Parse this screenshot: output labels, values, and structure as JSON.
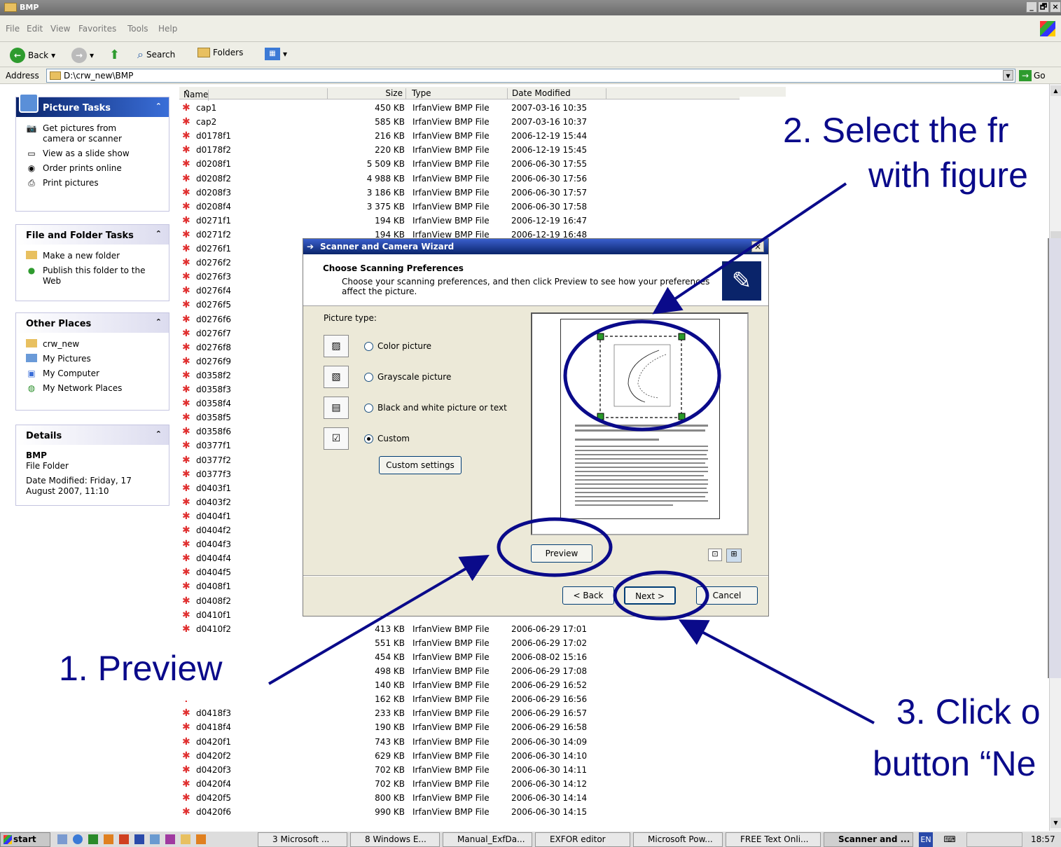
{
  "window": {
    "title": "BMP",
    "controls": [
      "_",
      "🗗",
      "×"
    ]
  },
  "menu": [
    "File",
    "Edit",
    "View",
    "Favorites",
    "Tools",
    "Help"
  ],
  "toolbar": {
    "back": "Back",
    "search": "Search",
    "folders": "Folders"
  },
  "address": {
    "label": "Address",
    "value": "D:\\crw_new\\BMP",
    "go": "Go"
  },
  "panels": {
    "picture_tasks": {
      "title": "Picture Tasks",
      "items": [
        "Get pictures from camera or scanner",
        "View as a slide show",
        "Order prints online",
        "Print pictures"
      ]
    },
    "file_tasks": {
      "title": "File and Folder Tasks",
      "items": [
        "Make a new folder",
        "Publish this folder to the Web"
      ]
    },
    "other_places": {
      "title": "Other Places",
      "items": [
        "crw_new",
        "My Pictures",
        "My Computer",
        "My Network Places"
      ]
    },
    "details": {
      "title": "Details",
      "name": "BMP",
      "kind": "File Folder",
      "modified": "Date Modified: Friday, 17 August 2007, 11:10"
    }
  },
  "columns": {
    "name": "Name",
    "size": "Size",
    "type": "Type",
    "date": "Date Modified"
  },
  "files": [
    {
      "name": "cap1",
      "size": "450 KB",
      "type": "IrfanView BMP File",
      "date": "2007-03-16 10:35"
    },
    {
      "name": "cap2",
      "size": "585 KB",
      "type": "IrfanView BMP File",
      "date": "2007-03-16 10:37"
    },
    {
      "name": "d0178f1",
      "size": "216 KB",
      "type": "IrfanView BMP File",
      "date": "2006-12-19 15:44"
    },
    {
      "name": "d0178f2",
      "size": "220 KB",
      "type": "IrfanView BMP File",
      "date": "2006-12-19 15:45"
    },
    {
      "name": "d0208f1",
      "size": "5 509 KB",
      "type": "IrfanView BMP File",
      "date": "2006-06-30 17:55"
    },
    {
      "name": "d0208f2",
      "size": "4 988 KB",
      "type": "IrfanView BMP File",
      "date": "2006-06-30 17:56"
    },
    {
      "name": "d0208f3",
      "size": "3 186 KB",
      "type": "IrfanView BMP File",
      "date": "2006-06-30 17:57"
    },
    {
      "name": "d0208f4",
      "size": "3 375 KB",
      "type": "IrfanView BMP File",
      "date": "2006-06-30 17:58"
    },
    {
      "name": "d0271f1",
      "size": "194 KB",
      "type": "IrfanView BMP File",
      "date": "2006-12-19 16:47"
    },
    {
      "name": "d0271f2",
      "size": "194 KB",
      "type": "IrfanView BMP File",
      "date": "2006-12-19 16:48"
    },
    {
      "name": "d0276f1",
      "size": "",
      "type": "",
      "date": ""
    },
    {
      "name": "d0276f2",
      "size": "",
      "type": "",
      "date": ""
    },
    {
      "name": "d0276f3",
      "size": "",
      "type": "",
      "date": ""
    },
    {
      "name": "d0276f4",
      "size": "",
      "type": "",
      "date": ""
    },
    {
      "name": "d0276f5",
      "size": "",
      "type": "",
      "date": ""
    },
    {
      "name": "d0276f6",
      "size": "",
      "type": "",
      "date": ""
    },
    {
      "name": "d0276f7",
      "size": "",
      "type": "",
      "date": ""
    },
    {
      "name": "d0276f8",
      "size": "",
      "type": "",
      "date": ""
    },
    {
      "name": "d0276f9",
      "size": "",
      "type": "",
      "date": ""
    },
    {
      "name": "d0358f2",
      "size": "",
      "type": "",
      "date": ""
    },
    {
      "name": "d0358f3",
      "size": "",
      "type": "",
      "date": ""
    },
    {
      "name": "d0358f4",
      "size": "",
      "type": "",
      "date": ""
    },
    {
      "name": "d0358f5",
      "size": "",
      "type": "",
      "date": ""
    },
    {
      "name": "d0358f6",
      "size": "",
      "type": "",
      "date": ""
    },
    {
      "name": "d0377f1",
      "size": "",
      "type": "",
      "date": ""
    },
    {
      "name": "d0377f2",
      "size": "",
      "type": "",
      "date": ""
    },
    {
      "name": "d0377f3",
      "size": "",
      "type": "",
      "date": ""
    },
    {
      "name": "d0403f1",
      "size": "",
      "type": "",
      "date": ""
    },
    {
      "name": "d0403f2",
      "size": "",
      "type": "",
      "date": ""
    },
    {
      "name": "d0404f1",
      "size": "",
      "type": "",
      "date": ""
    },
    {
      "name": "d0404f2",
      "size": "",
      "type": "",
      "date": ""
    },
    {
      "name": "d0404f3",
      "size": "",
      "type": "",
      "date": ""
    },
    {
      "name": "d0404f4",
      "size": "",
      "type": "",
      "date": ""
    },
    {
      "name": "d0404f5",
      "size": "",
      "type": "",
      "date": ""
    },
    {
      "name": "d0408f1",
      "size": "",
      "type": "",
      "date": ""
    },
    {
      "name": "d0408f2",
      "size": "",
      "type": "",
      "date": ""
    },
    {
      "name": "d0410f1",
      "size": "",
      "type": "",
      "date": ""
    },
    {
      "name": "d0410f2",
      "size": "413 KB",
      "type": "IrfanView BMP File",
      "date": "2006-06-29 17:01"
    },
    {
      "name": "",
      "size": "551 KB",
      "type": "IrfanView BMP File",
      "date": "2006-06-29 17:02"
    },
    {
      "name": "",
      "size": "454 KB",
      "type": "IrfanView BMP File",
      "date": "2006-08-02 15:16"
    },
    {
      "name": "",
      "size": "498 KB",
      "type": "IrfanView BMP File",
      "date": "2006-06-29 17:08"
    },
    {
      "name": "",
      "size": "140 KB",
      "type": "IrfanView BMP File",
      "date": "2006-06-29 16:52"
    },
    {
      "name": "",
      "size": "162 KB",
      "type": "IrfanView BMP File",
      "date": "2006-06-29 16:56"
    },
    {
      "name": "d0418f3",
      "size": "233 KB",
      "type": "IrfanView BMP File",
      "date": "2006-06-29 16:57"
    },
    {
      "name": "d0418f4",
      "size": "190 KB",
      "type": "IrfanView BMP File",
      "date": "2006-06-29 16:58"
    },
    {
      "name": "d0420f1",
      "size": "743 KB",
      "type": "IrfanView BMP File",
      "date": "2006-06-30 14:09"
    },
    {
      "name": "d0420f2",
      "size": "629 KB",
      "type": "IrfanView BMP File",
      "date": "2006-06-30 14:10"
    },
    {
      "name": "d0420f3",
      "size": "702 KB",
      "type": "IrfanView BMP File",
      "date": "2006-06-30 14:11"
    },
    {
      "name": "d0420f4",
      "size": "702 KB",
      "type": "IrfanView BMP File",
      "date": "2006-06-30 14:12"
    },
    {
      "name": "d0420f5",
      "size": "800 KB",
      "type": "IrfanView BMP File",
      "date": "2006-06-30 14:14"
    },
    {
      "name": "d0420f6",
      "size": "990 KB",
      "type": "IrfanView BMP File",
      "date": "2006-06-30 14:15"
    }
  ],
  "dialog": {
    "title": "Scanner and Camera Wizard",
    "heading": "Choose Scanning Preferences",
    "description": "Choose your scanning preferences, and then click Preview to see how your preferences affect the picture.",
    "picture_type_label": "Picture type:",
    "options": [
      "Color picture",
      "Grayscale picture",
      "Black and white picture or text",
      "Custom"
    ],
    "selected": "Custom",
    "custom_settings": "Custom settings",
    "preview": "Preview",
    "back": "< Back",
    "next": "Next >",
    "cancel": "Cancel",
    "close": "×"
  },
  "callouts": {
    "c1": "1. Preview",
    "c2a": "2. Select the fr",
    "c2b": "with figure",
    "c3a": "3. Click o",
    "c3b": "button “Ne"
  },
  "taskbar": {
    "start": "start",
    "buttons": [
      "3 Microsoft ...",
      "8 Windows E...",
      "Manual_ExfDa...",
      "EXFOR editor",
      "Microsoft Pow...",
      "FREE Text Onli...",
      "Scanner and ..."
    ],
    "lang": "EN",
    "clock": "18:57"
  },
  "colors": {
    "annotation": "#0a0a8a",
    "title_active": "#0a246a"
  }
}
